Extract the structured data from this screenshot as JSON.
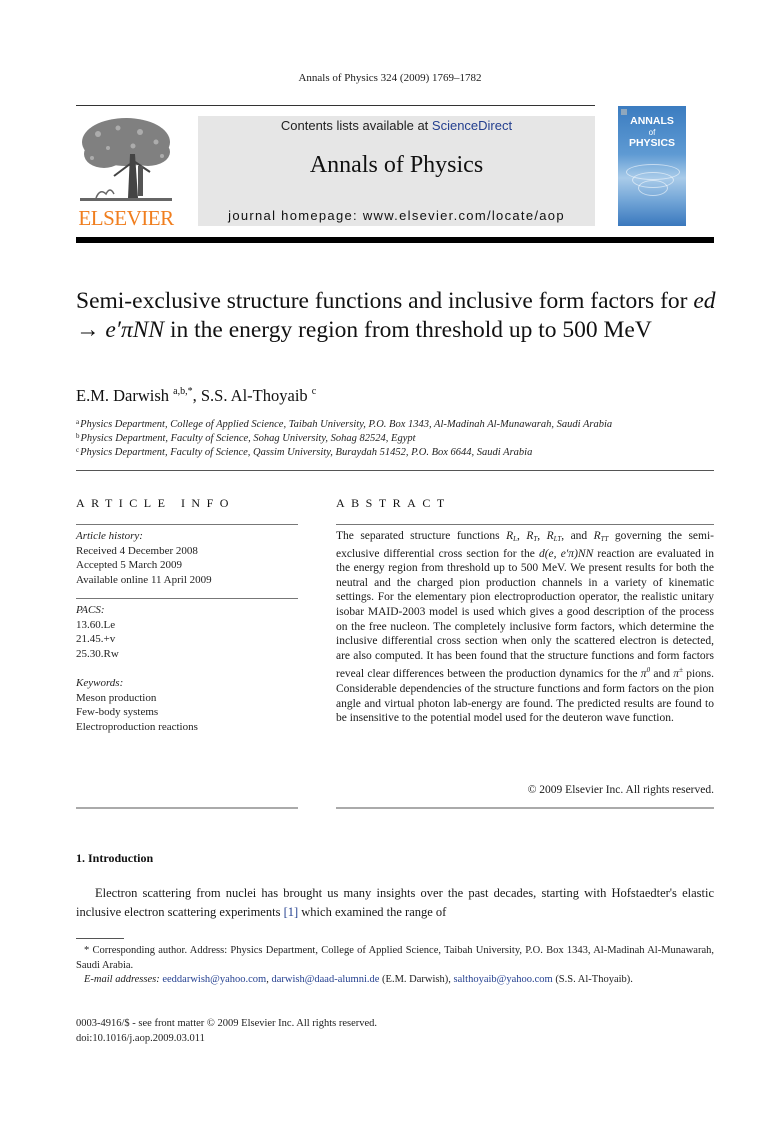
{
  "header": {
    "citation": "Annals of Physics 324 (2009) 1769–1782",
    "contents_prefix": "Contents lists available at ",
    "contents_link": "ScienceDirect",
    "journal_title": "Annals of Physics",
    "homepage": "journal homepage: www.elsevier.com/locate/aop",
    "publisher_logo_text": "ELSEVIER",
    "cover": {
      "line1": "ANNALS",
      "line2": "of",
      "line3": "PHYSICS"
    },
    "colors": {
      "elsevier_orange": "#f07e1e",
      "link_blue": "#233f8f",
      "banner_gray": "#e6e6e6",
      "cover_blue": "#3b7cc0"
    }
  },
  "article": {
    "title_part1": "Semi-exclusive structure functions and inclusive form factors for ",
    "title_math": "ed → e′πNN",
    "title_part2": " in the energy region from threshold up to 500 MeV",
    "authors": [
      {
        "name": "E.M. Darwish",
        "marks": "a,b,*"
      },
      {
        "name": "S.S. Al-Thoyaib",
        "marks": "c"
      }
    ],
    "affiliations": [
      {
        "mark": "a",
        "text": "Physics Department, College of Applied Science, Taibah University, P.O. Box 1343, Al-Madinah Al-Munawarah, Saudi Arabia"
      },
      {
        "mark": "b",
        "text": "Physics Department, Faculty of Science, Sohag University, Sohag 82524, Egypt"
      },
      {
        "mark": "c",
        "text": "Physics Department, Faculty of Science, Qassim University, Buraydah 51452, P.O. Box 6644, Saudi Arabia"
      }
    ]
  },
  "article_info": {
    "heading": "ARTICLE INFO",
    "history_label": "Article history:",
    "history": [
      "Received 4 December 2008",
      "Accepted 5 March 2009",
      "Available online 11 April 2009"
    ],
    "pacs_label": "PACS:",
    "pacs": [
      "13.60.Le",
      "21.45.+v",
      "25.30.Rw"
    ],
    "keywords_label": "Keywords:",
    "keywords": [
      "Meson production",
      "Few-body systems",
      "Electroproduction reactions"
    ]
  },
  "abstract": {
    "heading": "ABSTRACT",
    "t1": "The separated structure functions ",
    "t2": ", and ",
    "t3": " governing the semi-exclusive differential cross section for the ",
    "t3math": "d(e, e′π)NN",
    "t4": " reac­tion are evaluated in the energy region from threshold up to 500 MeV. We present results for both the neutral and the charged pion production channels in a variety of kinematic settings. For the elementary pion electroproduction operator, the realistic unitary isobar MAID-2003 model is used which gives a good description of the process on the free nucleon. The completely inclusive form factors, which determine the inclusive differential cross section when only the scattered electron is detected, are also computed. It has been found that the structure functions and form factors reveal clear differences between the production dynamics for the ",
    "t5": " and ",
    "t6": " pions. Considerable dependencies of the structure func­tions and form factors on the pion angle and virtual photon lab-energy are found. The predicted results are found to be insensitive to the potential model used for the deuteron wave function.",
    "copyright": "© 2009 Elsevier Inc. All rights reserved."
  },
  "introduction": {
    "heading": "1. Introduction",
    "text1": "Electron scattering from nuclei has brought us many insights over the past decades, starting with Hofstaedter's elastic inclusive electron scattering experiments ",
    "ref": "[1]",
    "text2": " which examined the range of"
  },
  "footnote": {
    "corresponding": "* Corresponding author. Address: Physics Department, College of Applied Science, Taibah University, P.O. Box 1343, Al-Madinah Al-Munawarah, Saudi Arabia.",
    "email_label": "E-mail addresses:",
    "email1": "eeddarwish@yahoo.com",
    "email2": "darwish@daad-alumni.de",
    "email2_owner": " (E.M. Darwish), ",
    "email3": "salthoyaib@yahoo.com",
    "email3_owner": " (S.S. Al-Thoyaib)."
  },
  "bottom": {
    "issn": "0003-4916/$ - see front matter © 2009 Elsevier Inc. All rights reserved.",
    "doi": "doi:10.1016/j.aop.2009.03.011"
  }
}
